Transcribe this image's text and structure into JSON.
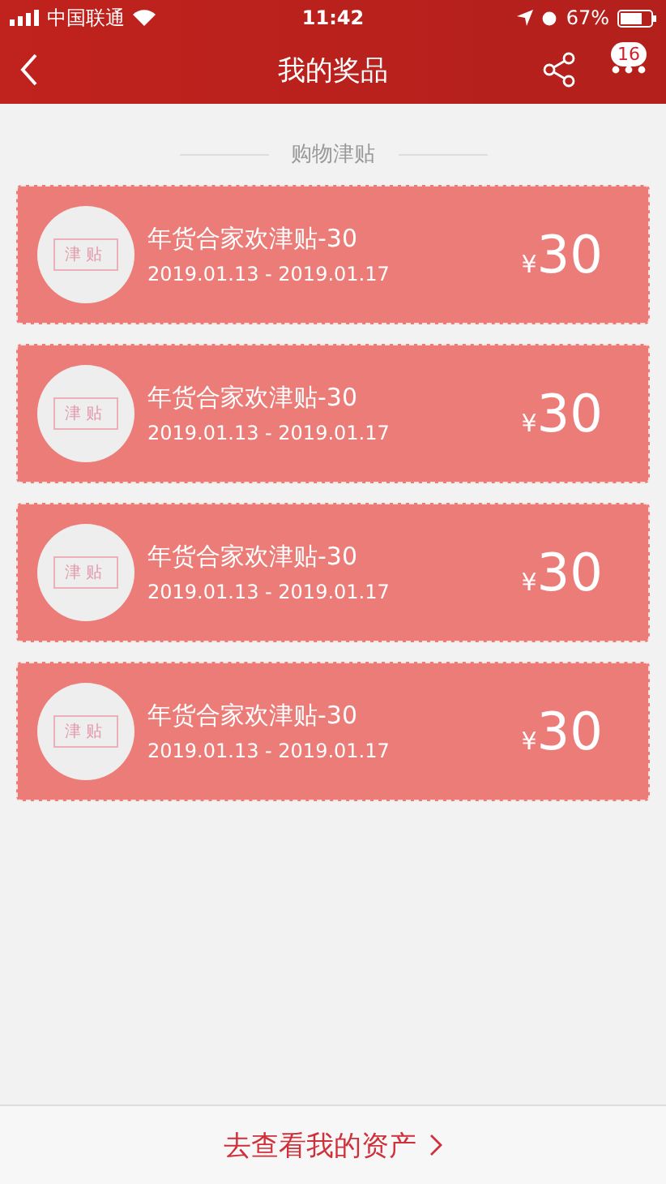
{
  "status_bar": {
    "carrier": "中国联通",
    "time": "11:42",
    "battery": "67%"
  },
  "nav": {
    "title": "我的奖品",
    "badge": "16"
  },
  "section": {
    "title": "购物津贴"
  },
  "coupons": [
    {
      "stamp": "津贴",
      "title": "年货合家欢津贴-30",
      "dates": "2019.01.13 - 2019.01.17",
      "currency": "¥",
      "amount": "30"
    },
    {
      "stamp": "津贴",
      "title": "年货合家欢津贴-30",
      "dates": "2019.01.13 - 2019.01.17",
      "currency": "¥",
      "amount": "30"
    },
    {
      "stamp": "津贴",
      "title": "年货合家欢津贴-30",
      "dates": "2019.01.13 - 2019.01.17",
      "currency": "¥",
      "amount": "30"
    },
    {
      "stamp": "津贴",
      "title": "年货合家欢津贴-30",
      "dates": "2019.01.13 - 2019.01.17",
      "currency": "¥",
      "amount": "30"
    }
  ],
  "footer": {
    "link": "去查看我的资产"
  }
}
